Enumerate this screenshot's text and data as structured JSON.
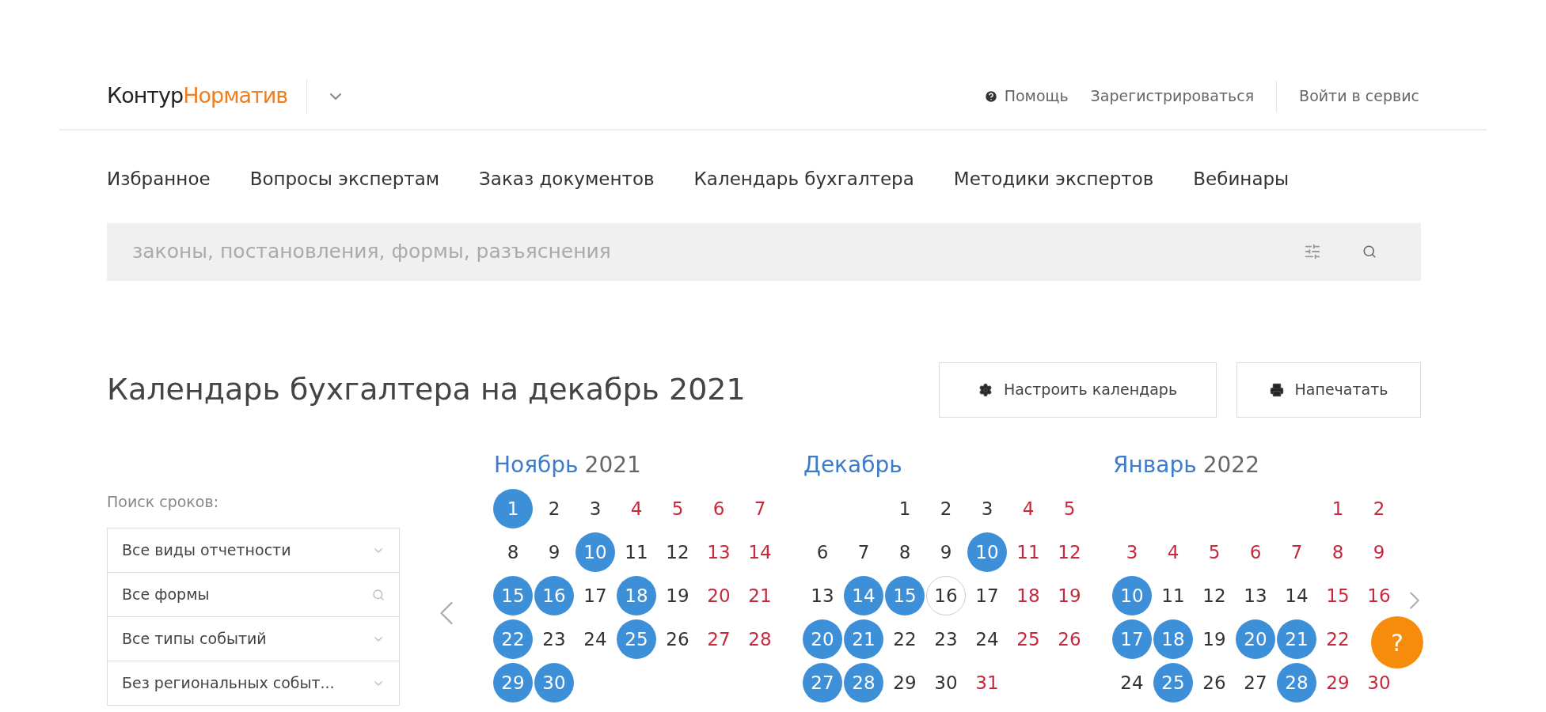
{
  "header": {
    "logo_primary": "Контур",
    "logo_secondary": "Норматив",
    "links": [
      {
        "kind": "help",
        "label": "Помощь"
      },
      {
        "kind": "plain",
        "label": "Зарегистрироваться"
      },
      {
        "kind": "login",
        "label": "Войти в сервис"
      }
    ]
  },
  "nav": [
    {
      "label": "Избранное"
    },
    {
      "label": "Вопросы экспертам"
    },
    {
      "label": "Заказ документов"
    },
    {
      "label": "Календарь бухгалтера"
    },
    {
      "label": "Методики экспертов"
    },
    {
      "label": "Вебинары"
    }
  ],
  "search": {
    "placeholder": "законы, постановления, формы, разъяснения"
  },
  "title": "Календарь бухгалтера на декабрь 2021",
  "actions": [
    {
      "kind": "settings",
      "label": "Настроить календарь"
    },
    {
      "kind": "print",
      "label": "Напечатать"
    }
  ],
  "filters": {
    "label": "Поиск сроков:",
    "fields": [
      {
        "kind": "select",
        "value": "Все виды отчетности"
      },
      {
        "kind": "search",
        "value": "Все формы"
      },
      {
        "kind": "select",
        "value": "Все типы событий"
      },
      {
        "kind": "select",
        "value": "Без региональных событ..."
      }
    ]
  },
  "months": [
    {
      "name": "Ноябрь",
      "year": "2021",
      "weeks": [
        [
          {
            "d": "1",
            "kind": "event"
          },
          {
            "d": "2",
            "kind": "plain"
          },
          {
            "d": "3",
            "kind": "plain"
          },
          {
            "d": "4",
            "kind": "holiday"
          },
          {
            "d": "5",
            "kind": "holiday"
          },
          {
            "d": "6",
            "kind": "holiday"
          },
          {
            "d": "7",
            "kind": "holiday"
          }
        ],
        [
          {
            "d": "8",
            "kind": "plain"
          },
          {
            "d": "9",
            "kind": "plain"
          },
          {
            "d": "10",
            "kind": "event"
          },
          {
            "d": "11",
            "kind": "plain"
          },
          {
            "d": "12",
            "kind": "plain"
          },
          {
            "d": "13",
            "kind": "holiday"
          },
          {
            "d": "14",
            "kind": "holiday"
          }
        ],
        [
          {
            "d": "15",
            "kind": "event"
          },
          {
            "d": "16",
            "kind": "event"
          },
          {
            "d": "17",
            "kind": "plain"
          },
          {
            "d": "18",
            "kind": "event"
          },
          {
            "d": "19",
            "kind": "plain"
          },
          {
            "d": "20",
            "kind": "holiday"
          },
          {
            "d": "21",
            "kind": "holiday"
          }
        ],
        [
          {
            "d": "22",
            "kind": "event"
          },
          {
            "d": "23",
            "kind": "plain"
          },
          {
            "d": "24",
            "kind": "plain"
          },
          {
            "d": "25",
            "kind": "event"
          },
          {
            "d": "26",
            "kind": "plain"
          },
          {
            "d": "27",
            "kind": "holiday"
          },
          {
            "d": "28",
            "kind": "holiday"
          }
        ],
        [
          {
            "d": "29",
            "kind": "event"
          },
          {
            "d": "30",
            "kind": "event"
          }
        ]
      ]
    },
    {
      "name": "Декабрь",
      "weeks": [
        [
          {
            "d": "1",
            "kind": "plain"
          },
          {
            "d": "2",
            "kind": "plain"
          },
          {
            "d": "3",
            "kind": "plain"
          },
          {
            "d": "4",
            "kind": "holiday"
          },
          {
            "d": "5",
            "kind": "holiday"
          }
        ],
        [
          {
            "d": "6",
            "kind": "plain"
          },
          {
            "d": "7",
            "kind": "plain"
          },
          {
            "d": "8",
            "kind": "plain"
          },
          {
            "d": "9",
            "kind": "plain"
          },
          {
            "d": "10",
            "kind": "event"
          },
          {
            "d": "11",
            "kind": "holiday"
          },
          {
            "d": "12",
            "kind": "holiday"
          }
        ],
        [
          {
            "d": "13",
            "kind": "plain"
          },
          {
            "d": "14",
            "kind": "event"
          },
          {
            "d": "15",
            "kind": "event"
          },
          {
            "d": "16",
            "kind": "today"
          },
          {
            "d": "17",
            "kind": "plain"
          },
          {
            "d": "18",
            "kind": "holiday"
          },
          {
            "d": "19",
            "kind": "holiday"
          }
        ],
        [
          {
            "d": "20",
            "kind": "event"
          },
          {
            "d": "21",
            "kind": "event"
          },
          {
            "d": "22",
            "kind": "plain"
          },
          {
            "d": "23",
            "kind": "plain"
          },
          {
            "d": "24",
            "kind": "plain"
          },
          {
            "d": "25",
            "kind": "holiday"
          },
          {
            "d": "26",
            "kind": "holiday"
          }
        ],
        [
          {
            "d": "27",
            "kind": "event"
          },
          {
            "d": "28",
            "kind": "event"
          },
          {
            "d": "29",
            "kind": "plain"
          },
          {
            "d": "30",
            "kind": "plain"
          },
          {
            "d": "31",
            "kind": "holiday"
          }
        ]
      ]
    },
    {
      "name": "Январь",
      "year": "2022",
      "weeks": [
        [
          {
            "d": "1",
            "kind": "holiday"
          },
          {
            "d": "2",
            "kind": "holiday"
          }
        ],
        [
          {
            "d": "3",
            "kind": "holiday"
          },
          {
            "d": "4",
            "kind": "holiday"
          },
          {
            "d": "5",
            "kind": "holiday"
          },
          {
            "d": "6",
            "kind": "holiday"
          },
          {
            "d": "7",
            "kind": "holiday"
          },
          {
            "d": "8",
            "kind": "holiday"
          },
          {
            "d": "9",
            "kind": "holiday"
          }
        ],
        [
          {
            "d": "10",
            "kind": "event"
          },
          {
            "d": "11",
            "kind": "plain"
          },
          {
            "d": "12",
            "kind": "plain"
          },
          {
            "d": "13",
            "kind": "plain"
          },
          {
            "d": "14",
            "kind": "plain"
          },
          {
            "d": "15",
            "kind": "holiday"
          },
          {
            "d": "16",
            "kind": "holiday"
          }
        ],
        [
          {
            "d": "17",
            "kind": "event"
          },
          {
            "d": "18",
            "kind": "event"
          },
          {
            "d": "19",
            "kind": "plain"
          },
          {
            "d": "20",
            "kind": "event"
          },
          {
            "d": "21",
            "kind": "event"
          },
          {
            "d": "22",
            "kind": "holiday"
          }
        ],
        [
          {
            "d": "24",
            "kind": "plain"
          },
          {
            "d": "25",
            "kind": "event"
          },
          {
            "d": "26",
            "kind": "plain"
          },
          {
            "d": "27",
            "kind": "plain"
          },
          {
            "d": "28",
            "kind": "event"
          },
          {
            "d": "29",
            "kind": "holiday"
          },
          {
            "d": "30",
            "kind": "holiday"
          }
        ]
      ]
    }
  ],
  "help_button": {
    "label": "?"
  }
}
